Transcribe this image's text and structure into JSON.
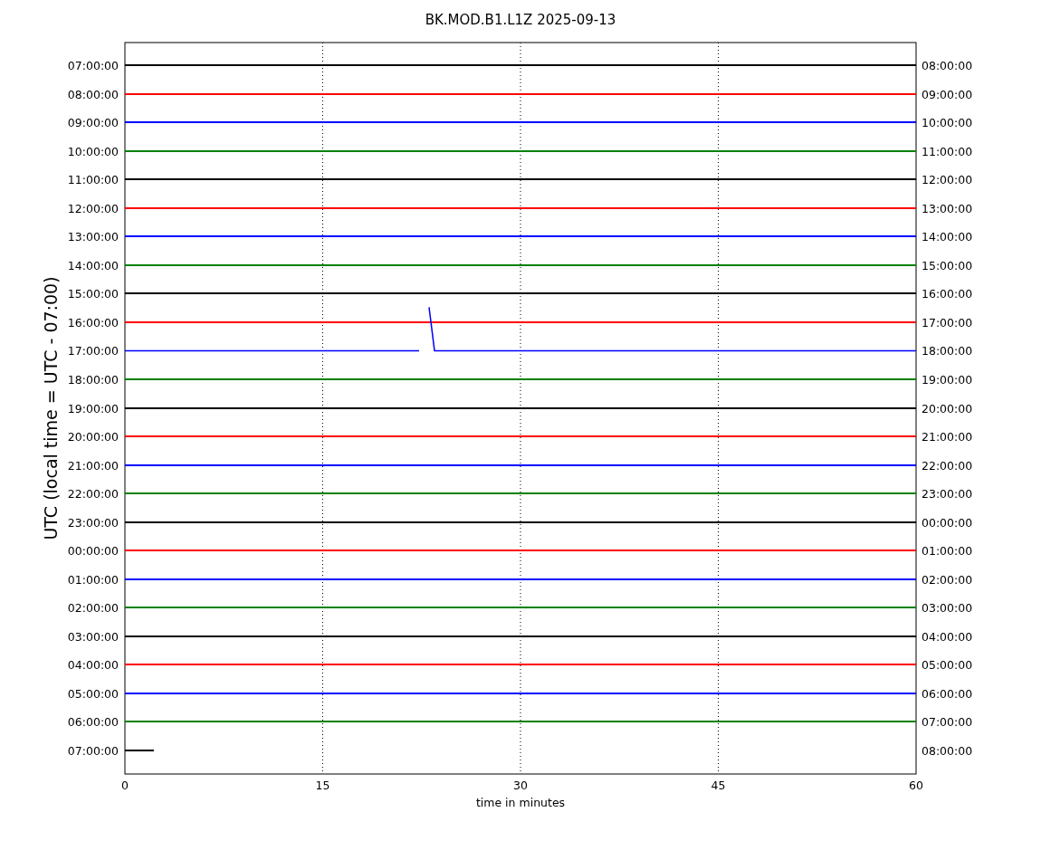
{
  "title": "BK.MOD.B1.L1Z 2025-09-13",
  "y_axis": {
    "label": "UTC (local time = UTC - 07:00)"
  },
  "x_axis": {
    "label": "time in minutes",
    "ticks": [
      "0",
      "15",
      "30",
      "45",
      "60"
    ]
  },
  "traces": [
    {
      "left": "07:00:00",
      "right": "08:00:00",
      "color": "#000000",
      "kind": "flat"
    },
    {
      "left": "08:00:00",
      "right": "09:00:00",
      "color": "#ff0000",
      "kind": "flat"
    },
    {
      "left": "09:00:00",
      "right": "10:00:00",
      "color": "#0000ff",
      "kind": "flat"
    },
    {
      "left": "10:00:00",
      "right": "11:00:00",
      "color": "#008000",
      "kind": "flat"
    },
    {
      "left": "11:00:00",
      "right": "12:00:00",
      "color": "#000000",
      "kind": "flat"
    },
    {
      "left": "12:00:00",
      "right": "13:00:00",
      "color": "#ff0000",
      "kind": "flat"
    },
    {
      "left": "13:00:00",
      "right": "14:00:00",
      "color": "#0000ff",
      "kind": "flat"
    },
    {
      "left": "14:00:00",
      "right": "15:00:00",
      "color": "#008000",
      "kind": "flat"
    },
    {
      "left": "15:00:00",
      "right": "16:00:00",
      "color": "#000000",
      "kind": "flat"
    },
    {
      "left": "16:00:00",
      "right": "17:00:00",
      "color": "#ff0000",
      "kind": "flat"
    },
    {
      "left": "17:00:00",
      "right": "18:00:00",
      "color": "#0000ff",
      "kind": "step"
    },
    {
      "left": "18:00:00",
      "right": "19:00:00",
      "color": "#008000",
      "kind": "flat"
    },
    {
      "left": "19:00:00",
      "right": "20:00:00",
      "color": "#000000",
      "kind": "flat"
    },
    {
      "left": "20:00:00",
      "right": "21:00:00",
      "color": "#ff0000",
      "kind": "flat"
    },
    {
      "left": "21:00:00",
      "right": "22:00:00",
      "color": "#0000ff",
      "kind": "flat"
    },
    {
      "left": "22:00:00",
      "right": "23:00:00",
      "color": "#008000",
      "kind": "flat"
    },
    {
      "left": "23:00:00",
      "right": "00:00:00",
      "color": "#000000",
      "kind": "flat"
    },
    {
      "left": "00:00:00",
      "right": "01:00:00",
      "color": "#ff0000",
      "kind": "flat"
    },
    {
      "left": "01:00:00",
      "right": "02:00:00",
      "color": "#0000ff",
      "kind": "flat"
    },
    {
      "left": "02:00:00",
      "right": "03:00:00",
      "color": "#008000",
      "kind": "flat"
    },
    {
      "left": "03:00:00",
      "right": "04:00:00",
      "color": "#000000",
      "kind": "flat"
    },
    {
      "left": "04:00:00",
      "right": "05:00:00",
      "color": "#ff0000",
      "kind": "flat"
    },
    {
      "left": "05:00:00",
      "right": "06:00:00",
      "color": "#0000ff",
      "kind": "flat"
    },
    {
      "left": "06:00:00",
      "right": "07:00:00",
      "color": "#008000",
      "kind": "flat"
    },
    {
      "left": "07:00:00",
      "right": "08:00:00",
      "color": "#000000",
      "kind": "partial"
    }
  ]
}
